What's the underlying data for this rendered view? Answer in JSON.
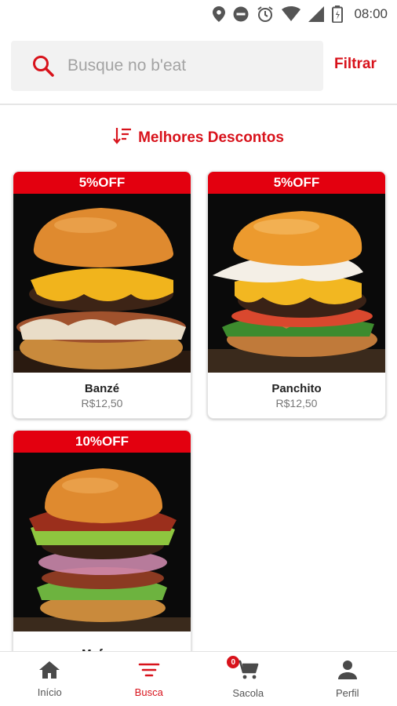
{
  "status_bar": {
    "time": "08:00",
    "icons": [
      "location-icon",
      "do-not-disturb-icon",
      "alarm-icon",
      "wifi-icon",
      "signal-icon",
      "battery-icon"
    ]
  },
  "search": {
    "placeholder": "Busque no b'eat",
    "value": "",
    "filter_label": "Filtrar"
  },
  "sort": {
    "icon": "sort-icon",
    "label": "Melhores Descontos"
  },
  "products": [
    {
      "badge": "5%OFF",
      "name": "Banzé",
      "price": "R$12,50"
    },
    {
      "badge": "5%OFF",
      "name": "Panchito",
      "price": "R$12,50"
    },
    {
      "badge": "10%OFF",
      "name": "Mufasa",
      "price": ""
    }
  ],
  "bottom_nav": {
    "items": [
      {
        "label": "Início",
        "icon": "home-icon",
        "active": false
      },
      {
        "label": "Busca",
        "icon": "filter-icon",
        "active": true
      },
      {
        "label": "Sacola",
        "icon": "cart-icon",
        "active": false,
        "badge": "0"
      },
      {
        "label": "Perfil",
        "icon": "person-icon",
        "active": false
      }
    ]
  },
  "colors": {
    "accent": "#d8121b",
    "badge": "#e3000f",
    "search_bg": "#f2f2f2"
  }
}
